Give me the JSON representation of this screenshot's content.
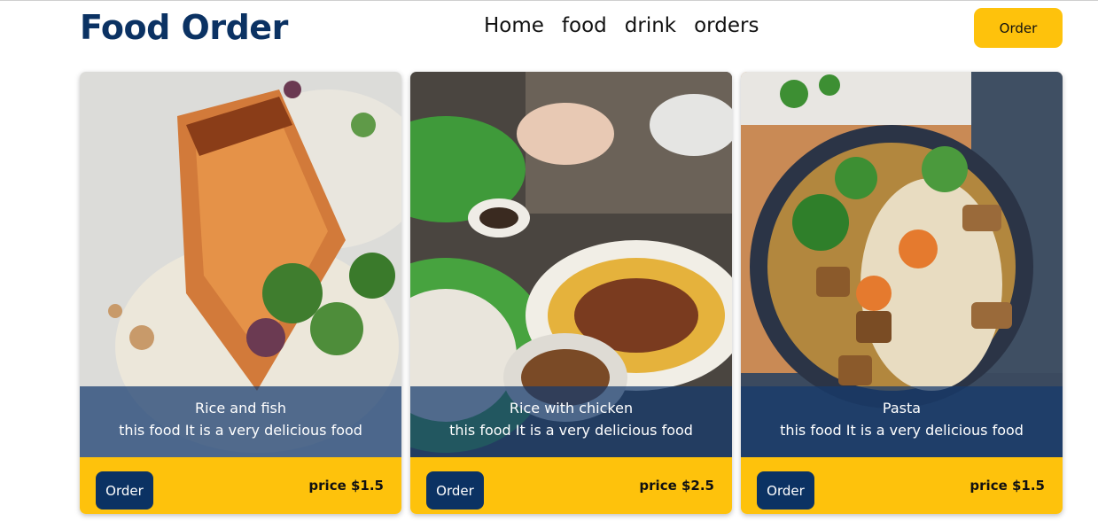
{
  "header": {
    "logo": "Food Order",
    "nav": [
      "Home",
      "food",
      "drink",
      "orders"
    ],
    "order_label": "Order"
  },
  "cards": [
    {
      "title": "Rice and fish",
      "desc": "this food It is a very delicious food",
      "order_label": "Order",
      "price": "price $1.5"
    },
    {
      "title": "Rice with chicken",
      "desc": "this food It is a very delicious food",
      "order_label": "Order",
      "price": "price $2.5"
    },
    {
      "title": "Pasta",
      "desc": "this food It is a very delicious food",
      "order_label": "Order",
      "price": "price $1.5"
    }
  ],
  "colors": {
    "brand": "#0b3263",
    "accent": "#fec20c"
  }
}
